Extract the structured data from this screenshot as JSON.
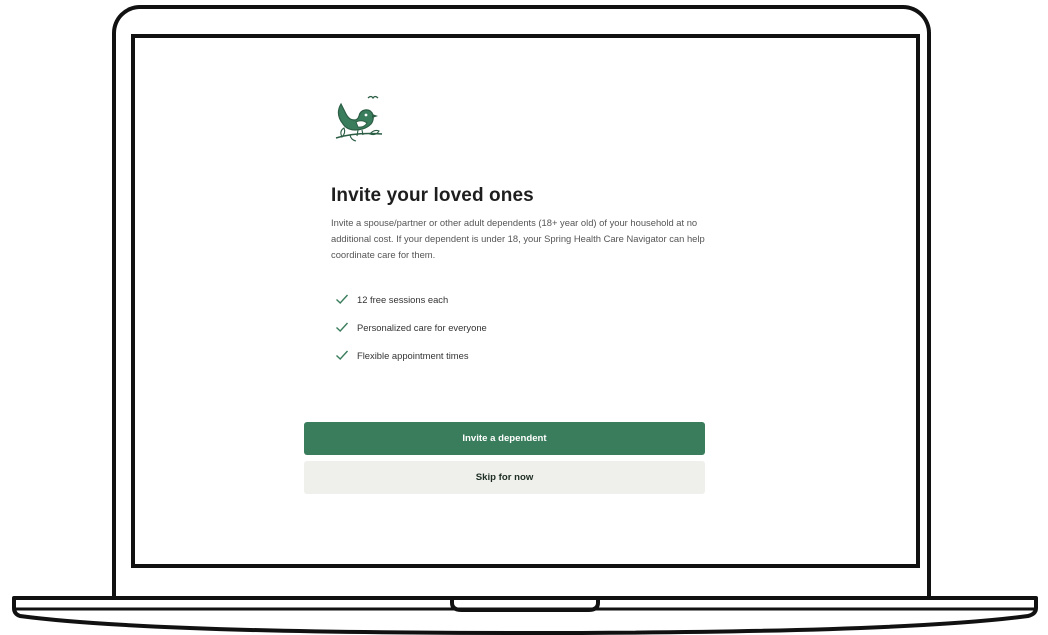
{
  "colors": {
    "brand_green": "#3a7d5c",
    "secondary_button_bg": "#efefec",
    "title_text": "#1e1e1e",
    "body_text": "#555555"
  },
  "logo": {
    "icon": "bird-on-branch-icon"
  },
  "invite": {
    "title": "Invite your loved ones",
    "description": "Invite a spouse/partner or other adult dependents (18+ year old) of your household at no additional cost. If your dependent is under 18, your Spring Health Care Navigator can help coordinate care for them.",
    "features": [
      "12 free sessions each",
      "Personalized care for everyone",
      "Flexible appointment times"
    ],
    "feature_icon": "checkmark-icon"
  },
  "actions": {
    "primary_label": "Invite a dependent",
    "secondary_label": "Skip for now"
  }
}
